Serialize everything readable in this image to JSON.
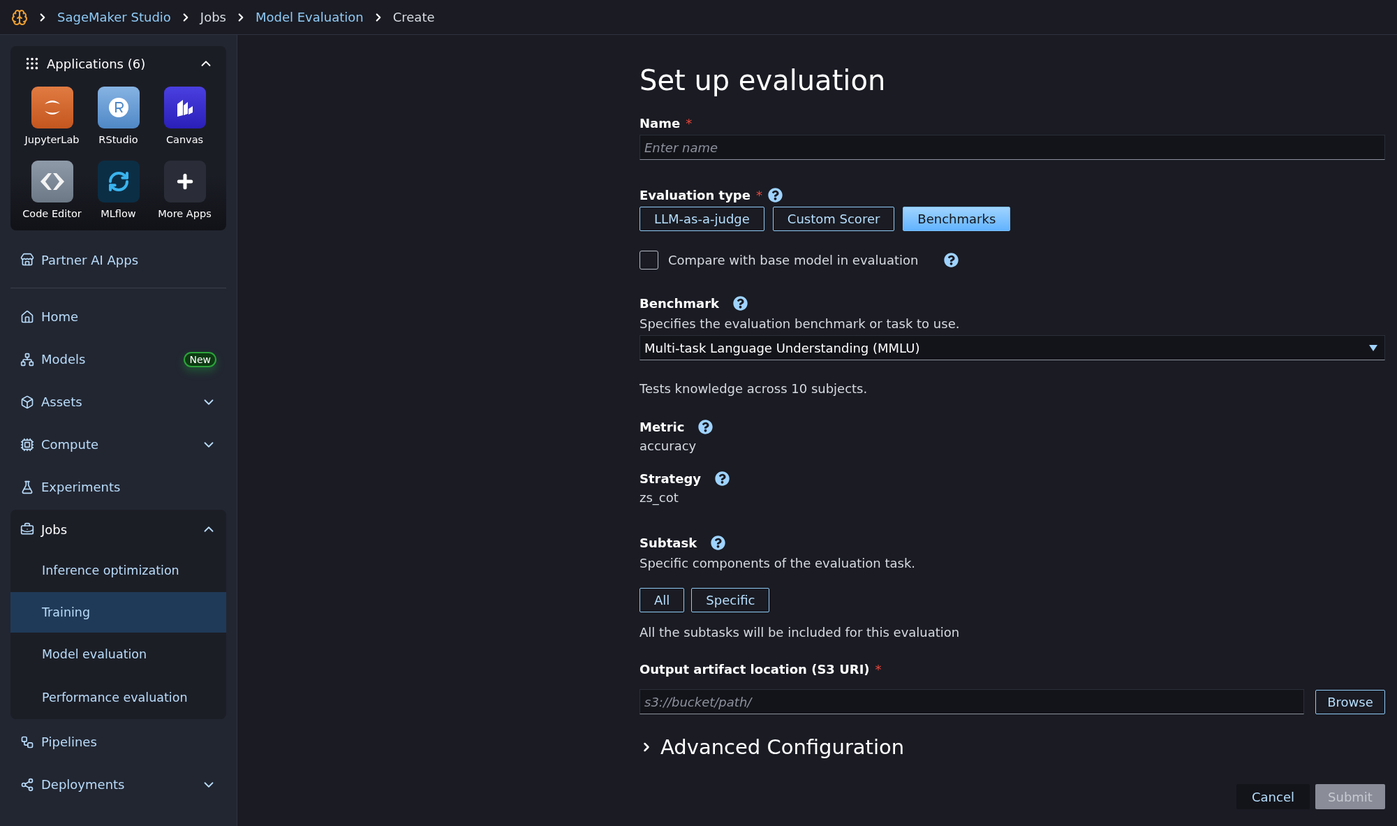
{
  "breadcrumb": [
    {
      "label": "SageMaker Studio",
      "link": true
    },
    {
      "label": "Jobs",
      "link": false
    },
    {
      "label": "Model Evaluation",
      "link": true
    },
    {
      "label": "Create",
      "link": false
    }
  ],
  "sidebar": {
    "applications": {
      "title": "Applications (6)",
      "expanded": true,
      "apps": [
        {
          "label": "JupyterLab",
          "kind": "jupyter"
        },
        {
          "label": "RStudio",
          "kind": "rstudio"
        },
        {
          "label": "Canvas",
          "kind": "canvas"
        },
        {
          "label": "Code Editor",
          "kind": "code"
        },
        {
          "label": "MLflow",
          "kind": "mlflow"
        },
        {
          "label": "More Apps",
          "kind": "more"
        }
      ]
    },
    "partner": {
      "label": "Partner AI Apps"
    },
    "items": [
      {
        "label": "Home",
        "selected": false
      },
      {
        "label": "Models",
        "selected": false,
        "badge": "New"
      },
      {
        "label": "Assets",
        "selected": false,
        "expanded": false
      },
      {
        "label": "Compute",
        "selected": false,
        "expanded": false
      },
      {
        "label": "Experiments",
        "selected": false
      },
      {
        "label": "Jobs",
        "selected": false,
        "expanded": true,
        "children": [
          {
            "label": "Inference optimization",
            "selected": false
          },
          {
            "label": "Training",
            "selected": true
          },
          {
            "label": "Model evaluation",
            "selected": false
          },
          {
            "label": "Performance evaluation",
            "selected": false
          }
        ]
      },
      {
        "label": "Pipelines",
        "selected": false
      },
      {
        "label": "Deployments",
        "selected": false,
        "expanded": false
      }
    ]
  },
  "form": {
    "title": "Set up evaluation",
    "name": {
      "label": "Name",
      "required_mark": "*",
      "placeholder": "Enter name"
    },
    "evaluation_type": {
      "label": "Evaluation type",
      "required_mark": "*",
      "options": [
        {
          "label": "LLM-as-a-judge",
          "selected": false
        },
        {
          "label": "Custom Scorer",
          "selected": false
        },
        {
          "label": "Benchmarks",
          "selected": true
        }
      ]
    },
    "compare": {
      "label": "Compare with base model in evaluation",
      "checked": false
    },
    "benchmark": {
      "label": "Benchmark",
      "description": "Specifies the evaluation benchmark or task to use.",
      "value": "Multi-task Language Understanding (MMLU)",
      "note": "Tests knowledge across 10 subjects."
    },
    "metric": {
      "label": "Metric",
      "value": "accuracy"
    },
    "strategy": {
      "label": "Strategy",
      "value": "zs_cot"
    },
    "subtask": {
      "label": "Subtask",
      "description": "Specific components of the evaluation task.",
      "options": [
        {
          "label": "All",
          "selected": false
        },
        {
          "label": "Specific",
          "selected": false
        }
      ],
      "note": "All the subtasks will be included for this evaluation"
    },
    "output": {
      "label": "Output artifact location (S3 URI)",
      "required_mark": "*",
      "placeholder": "s3://bucket/path/",
      "browse": "Browse"
    },
    "advanced": {
      "label": "Advanced Configuration",
      "expanded": false
    },
    "actions": {
      "cancel": "Cancel",
      "submit": {
        "label": "Submit",
        "disabled": true
      }
    }
  }
}
